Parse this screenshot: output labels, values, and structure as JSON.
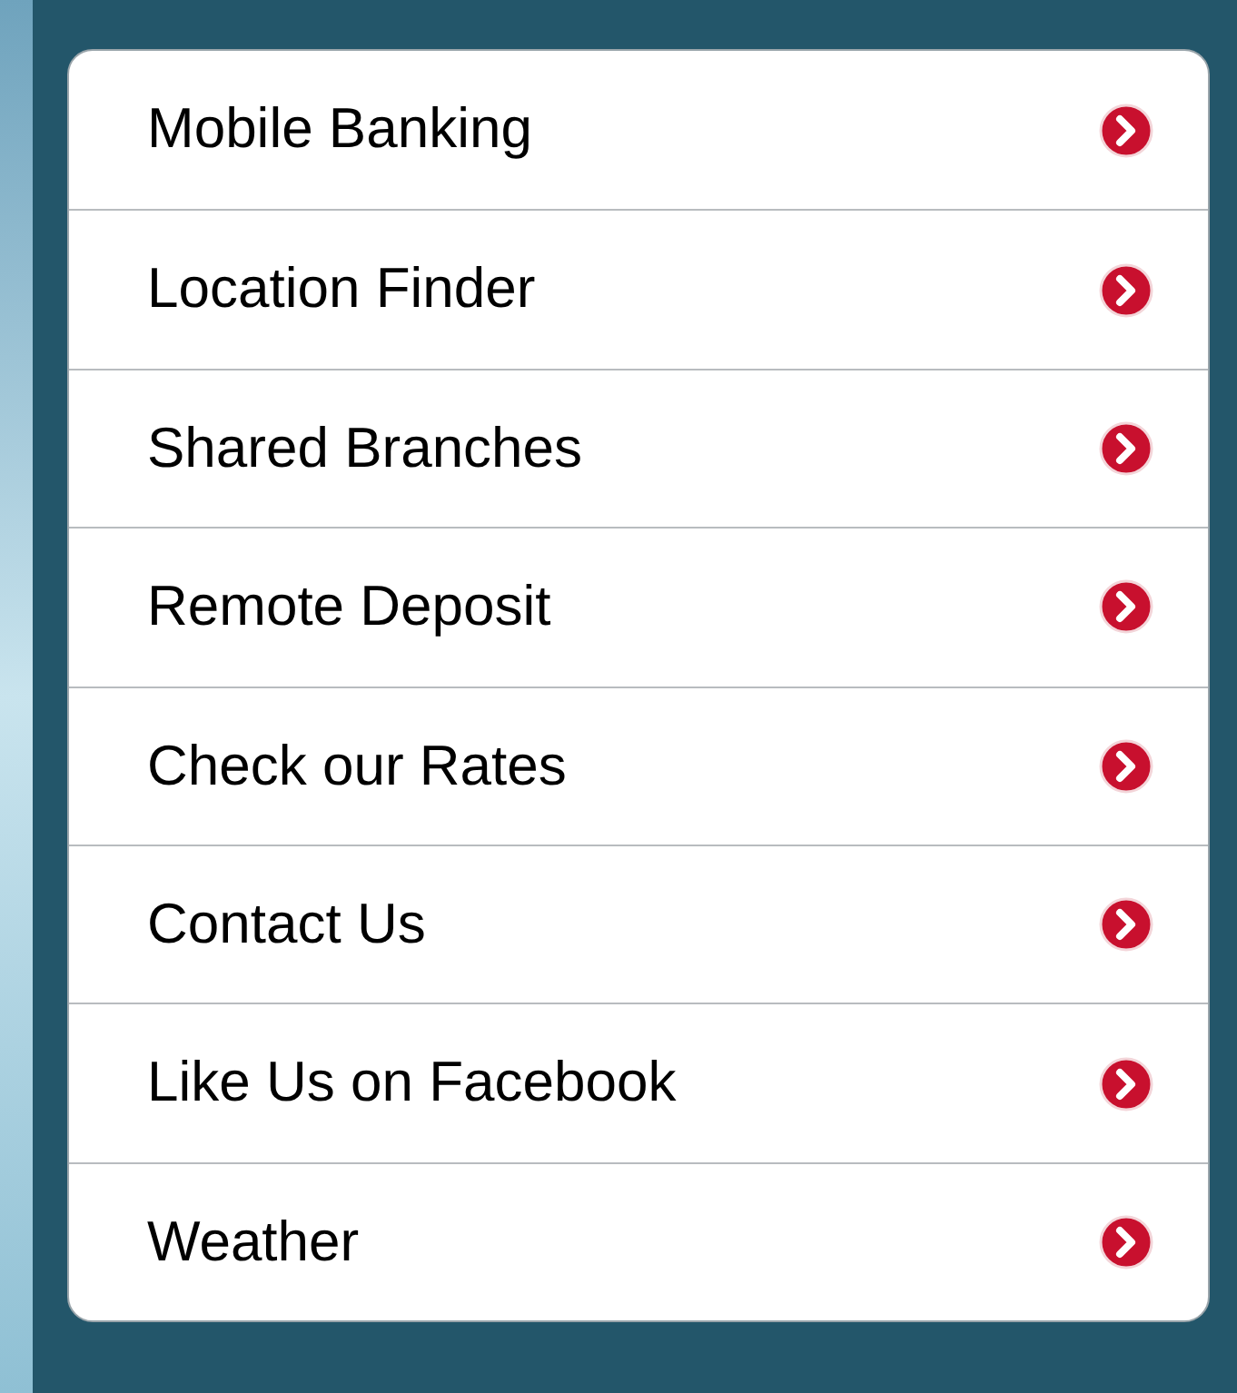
{
  "menu": {
    "items": [
      {
        "label": "Mobile Banking"
      },
      {
        "label": "Location Finder"
      },
      {
        "label": "Shared Branches"
      },
      {
        "label": "Remote Deposit"
      },
      {
        "label": "Check our Rates"
      },
      {
        "label": "Contact Us"
      },
      {
        "label": "Like Us on Facebook"
      },
      {
        "label": "Weather"
      }
    ]
  }
}
